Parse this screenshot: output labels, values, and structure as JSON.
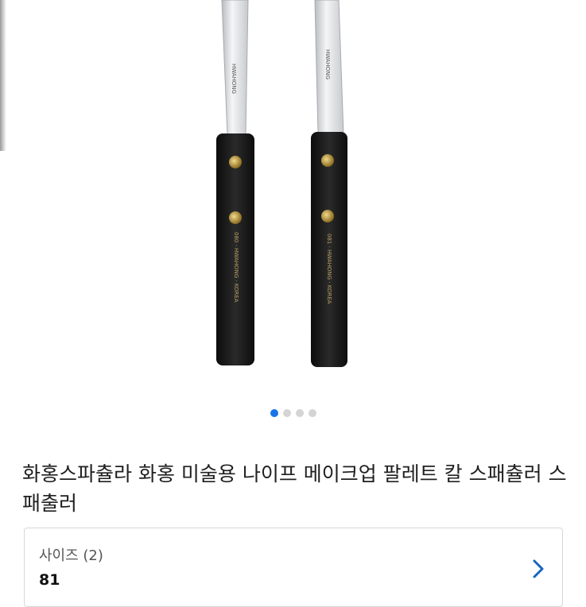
{
  "gallery": {
    "image_name": "palette-knife-photo",
    "knife_left_label": "HWAHONG",
    "knife_right_label": "HWAHONG",
    "handle_left_text": "080 · HWAHONG · KOREA",
    "handle_right_text": "081 · HWAHONG · KOREA",
    "page_dots": [
      true,
      false,
      false,
      false
    ]
  },
  "product": {
    "title": "화홍스파츌라 화홍 미술용 나이프 메이크업 팔레트 칼 스패츌러 스패출러"
  },
  "option": {
    "label": "사이즈 (2)",
    "value": "81",
    "chevron_icon": "chevron-right-icon"
  },
  "colors": {
    "accent": "#1a73e8",
    "chevron": "#1565c0"
  }
}
